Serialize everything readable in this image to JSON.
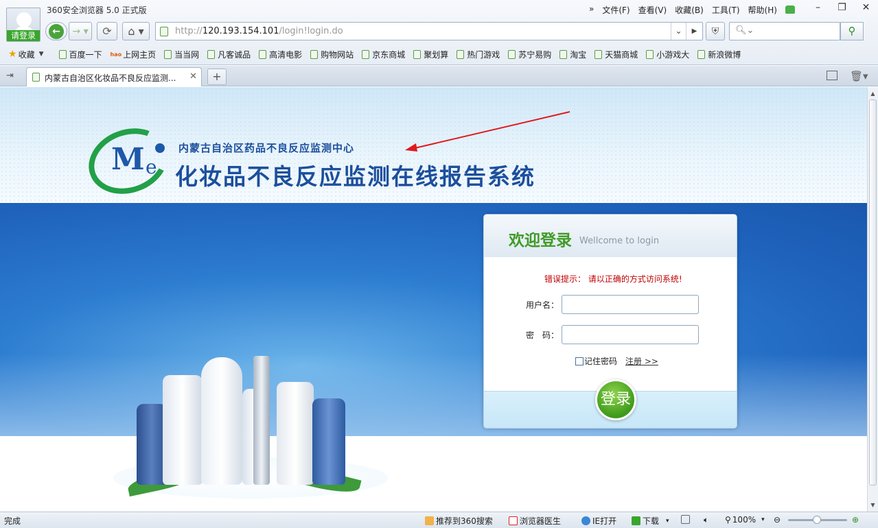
{
  "browser": {
    "app_title": "360安全浏览器 5.0 正式版",
    "login_badge": "请登录",
    "menu": [
      "文件(F)",
      "查看(V)",
      "收藏(B)",
      "工具(T)",
      "帮助(H)"
    ],
    "address": {
      "scheme": "http://",
      "host": "120.193.154.101",
      "path": "/login!login.do"
    },
    "favorites_label": "收藏",
    "favorites": [
      "百度一下",
      "上网主页",
      "当当网",
      "凡客诚品",
      "高清电影",
      "购物网站",
      "京东商城",
      "聚划算",
      "热门游戏",
      "苏宁易购",
      "淘宝",
      "天猫商城",
      "小游戏大",
      "新浪微博"
    ],
    "tab": {
      "title": "内蒙古自治区化妆品不良反应监测..."
    }
  },
  "page": {
    "org_name": "内蒙古自治区药品不良反应监测中心",
    "system_name": "化妆品不良反应监测在线报告系统",
    "logo_letters": {
      "m": "M",
      "e": "e"
    },
    "login": {
      "welcome": "欢迎登录",
      "welcome_en": "Wellcome to login",
      "error": "错误提示： 请以正确的方式访问系统!",
      "username_label": "用户名：",
      "password_label": "密　码：",
      "remember": "记住密码",
      "register": "注册 >>",
      "submit": "登录"
    }
  },
  "statusbar": {
    "status": "完成",
    "recommend": "推荐到360搜索",
    "doctor": "浏览器医生",
    "ie_open": "IE打开",
    "download": "下载",
    "zoom": "100%"
  },
  "colors": {
    "accent_green": "#3f9b26",
    "header_blue": "#1c4f9c",
    "error_red": "#c00000",
    "banner_blue": "#1f63bd"
  }
}
